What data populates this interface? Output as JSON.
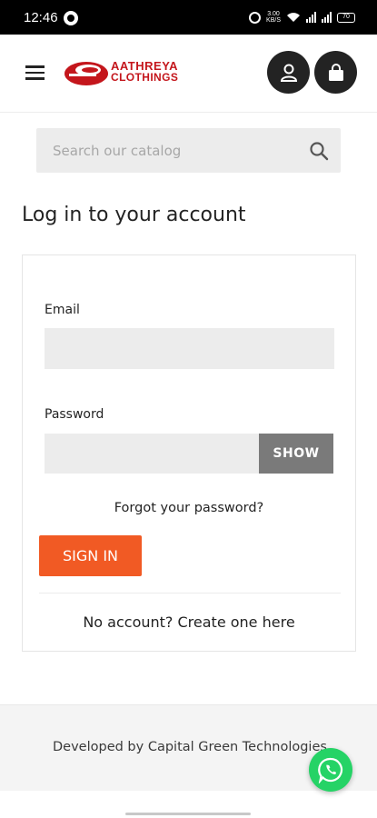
{
  "status_bar": {
    "time": "12:46",
    "network_speed_value": "3.00",
    "network_speed_unit": "KB/S",
    "battery_level": "70"
  },
  "header": {
    "brand_line1": "AATHREYA",
    "brand_line2": "CLOTHINGS",
    "brand_color": "#c4161c",
    "icons": {
      "menu": "hamburger-menu-icon",
      "account": "user-icon",
      "cart": "shopping-bag-icon"
    }
  },
  "search": {
    "placeholder": "Search our catalog",
    "icon": "search-icon"
  },
  "page": {
    "title": "Log in to your account"
  },
  "login_form": {
    "email_label": "Email",
    "email_value": "",
    "password_label": "Password",
    "password_value": "",
    "show_label": "SHOW",
    "forgot_label": "Forgot your password?",
    "signin_label": "SIGN IN",
    "create_account_label": "No account? Create one here"
  },
  "footer": {
    "text": "Developed by Capital Green Technologies"
  },
  "colors": {
    "accent": "#f15a24",
    "dark": "#232323",
    "whatsapp": "#25d366"
  },
  "whatsapp": {
    "icon": "whatsapp-icon"
  }
}
